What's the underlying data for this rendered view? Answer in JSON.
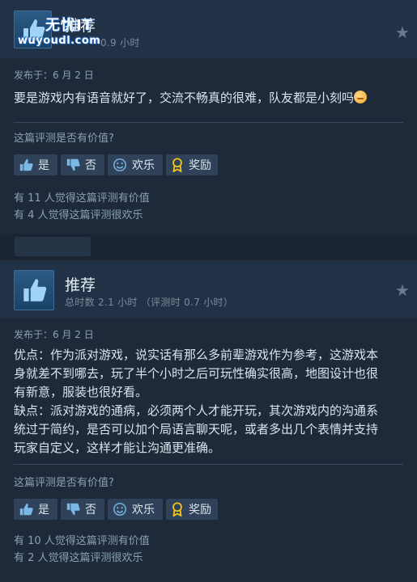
{
  "review1": {
    "title": "推荐",
    "playtime": "0.9 小时",
    "posted": "发布于：6 月 2 日",
    "text": "要是游戏内有语音就好了，交流不畅真的很难，队友都是小刻吗",
    "helpful_question": "这篇评测是否有价值?",
    "buttons": {
      "yes": "是",
      "no": "否",
      "funny": "欢乐",
      "award": "奖励"
    },
    "stats_helpful": "有 11 人觉得这篇评测有价值",
    "stats_funny": "有 4 人觉得这篇评测很欢乐"
  },
  "watermark": {
    "cn": "无忧IT",
    "en": "wuyoudl.com"
  },
  "review2": {
    "title": "推荐",
    "playtime": "总时数 2.1 小时 （评测时 0.7 小时）",
    "posted": "发布于：6 月 2 日",
    "text_lines": [
      "优点：作为派对游戏，说实话有那么多前辈游戏作为参考，这游戏本",
      "身就差不到哪去，玩了半个小时之后可玩性确实很高，地图设计也很",
      "有新意，服装也很好看。",
      "缺点：派对游戏的通病，必须两个人才能开玩，其次游戏内的沟通系",
      "统过于简约，是否可以加个局语言聊天呢，或者多出几个表情并支持",
      "玩家自定义，这样才能让沟通更准确。"
    ],
    "helpful_question": "这篇评测是否有价值?",
    "buttons": {
      "yes": "是",
      "no": "否",
      "funny": "欢乐",
      "award": "奖励"
    },
    "stats_helpful": "有 10 人觉得这篇评测有价值",
    "stats_funny": "有 2 人觉得这篇评测很欢乐"
  },
  "icons": {
    "thumb_up": "thumbs-up-icon",
    "thumb_down": "thumbs-down-icon",
    "smile": "smile-icon",
    "award": "award-icon",
    "star": "star-icon"
  },
  "colors": {
    "bg": "#1b2838",
    "button": "#2f4259",
    "award_gold": "#f5c518"
  }
}
